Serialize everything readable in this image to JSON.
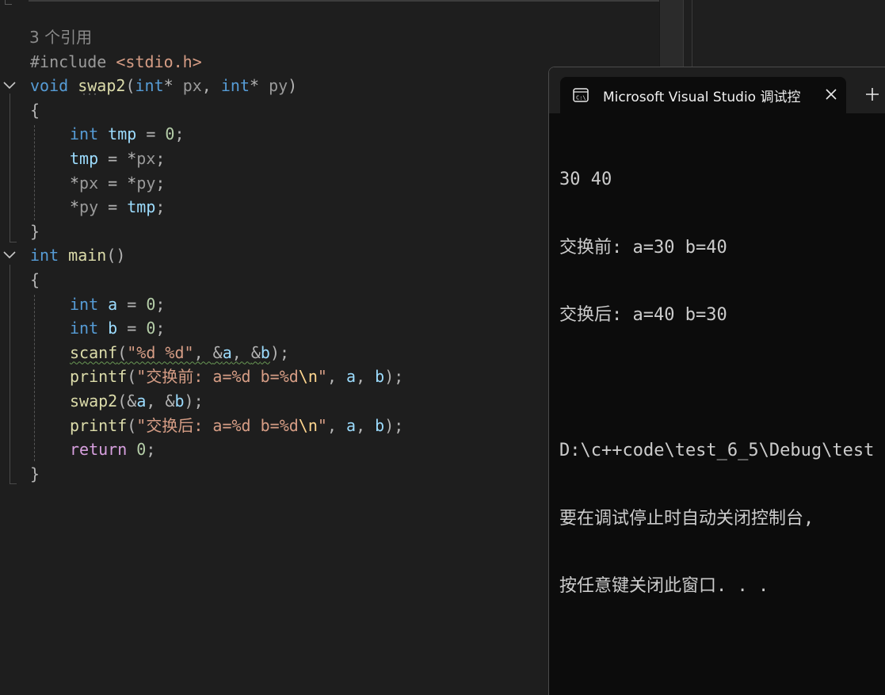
{
  "editor": {
    "codelens": "3 个引用",
    "include": {
      "directive": "#include",
      "header": "<stdio.h>"
    },
    "swap2": {
      "ret": "void",
      "name": "swap2",
      "open": "(",
      "t1": "int",
      "star1": "*",
      "p1": " px",
      "comma": ", ",
      "t2": "int",
      "star2": "*",
      "p2": " py",
      "close": ")",
      "brace_open": "{",
      "l1": {
        "type": "int",
        "var": "tmp",
        "eq": " = ",
        "num": "0",
        "semi": ";"
      },
      "l2": {
        "var": "tmp",
        "eq": " = ",
        "deref": "*",
        "p": "px",
        "semi": ";"
      },
      "l3": {
        "d1": "*",
        "p1": "px",
        "eq": " = ",
        "d2": "*",
        "p2": "py",
        "semi": ";"
      },
      "l4": {
        "d1": "*",
        "p1": "py",
        "eq": " = ",
        "var": "tmp",
        "semi": ";"
      },
      "brace_close": "}"
    },
    "main": {
      "ret": "int",
      "name": "main",
      "parens": "()",
      "brace_open": "{",
      "a": {
        "type": "int",
        "var": "a",
        "eq": " = ",
        "num": "0",
        "semi": ";"
      },
      "b": {
        "type": "int",
        "var": "b",
        "eq": " = ",
        "num": "0",
        "semi": ";"
      },
      "scanf": {
        "fn": "scanf",
        "open": "(",
        "fmt": "\"%d %d\"",
        "c1": ", ",
        "amp1": "&",
        "a": "a",
        "c2": ", ",
        "amp2": "&",
        "b": "b",
        "close": ");"
      },
      "printf1": {
        "fn": "printf",
        "open": "(",
        "str": "\"交换前: a=%d b=%d",
        "esc": "\\n",
        "endq": "\"",
        "c1": ", ",
        "a": "a",
        "c2": ", ",
        "b": "b",
        "close": ");"
      },
      "swapcall": {
        "fn": "swap2",
        "open": "(",
        "amp1": "&",
        "a": "a",
        "c": ", ",
        "amp2": "&",
        "b": "b",
        "close": ");"
      },
      "printf2": {
        "fn": "printf",
        "open": "(",
        "str": "\"交换后: a=%d b=%d",
        "esc": "\\n",
        "endq": "\"",
        "c1": ", ",
        "a": "a",
        "c2": ", ",
        "b": "b",
        "close": ");"
      },
      "ret_stmt": {
        "kw": "return",
        "num": " 0",
        "semi": ";"
      },
      "brace_close": "}"
    }
  },
  "console": {
    "tab_title": "Microsoft Visual Studio 调试控",
    "lines": [
      "30 40",
      "交换前: a=30 b=40",
      "交换后: a=40 b=30",
      "",
      "D:\\c++code\\test_6_5\\Debug\\test",
      "要在调试停止时自动关闭控制台,",
      "按任意键关闭此窗口. . ."
    ]
  },
  "colors": {
    "keyword": "#569cd6",
    "function": "#dcdcaa",
    "string": "#d69d85",
    "number": "#b5cea8",
    "variable": "#9cdcfe",
    "control": "#d8a0df",
    "console_bg": "#0c0c0c",
    "editor_bg": "#1e1e1e"
  },
  "icons": {
    "tab": "console-app-icon",
    "close": "close-icon",
    "new_tab": "plus-icon",
    "fold": "chevron-down-icon"
  }
}
